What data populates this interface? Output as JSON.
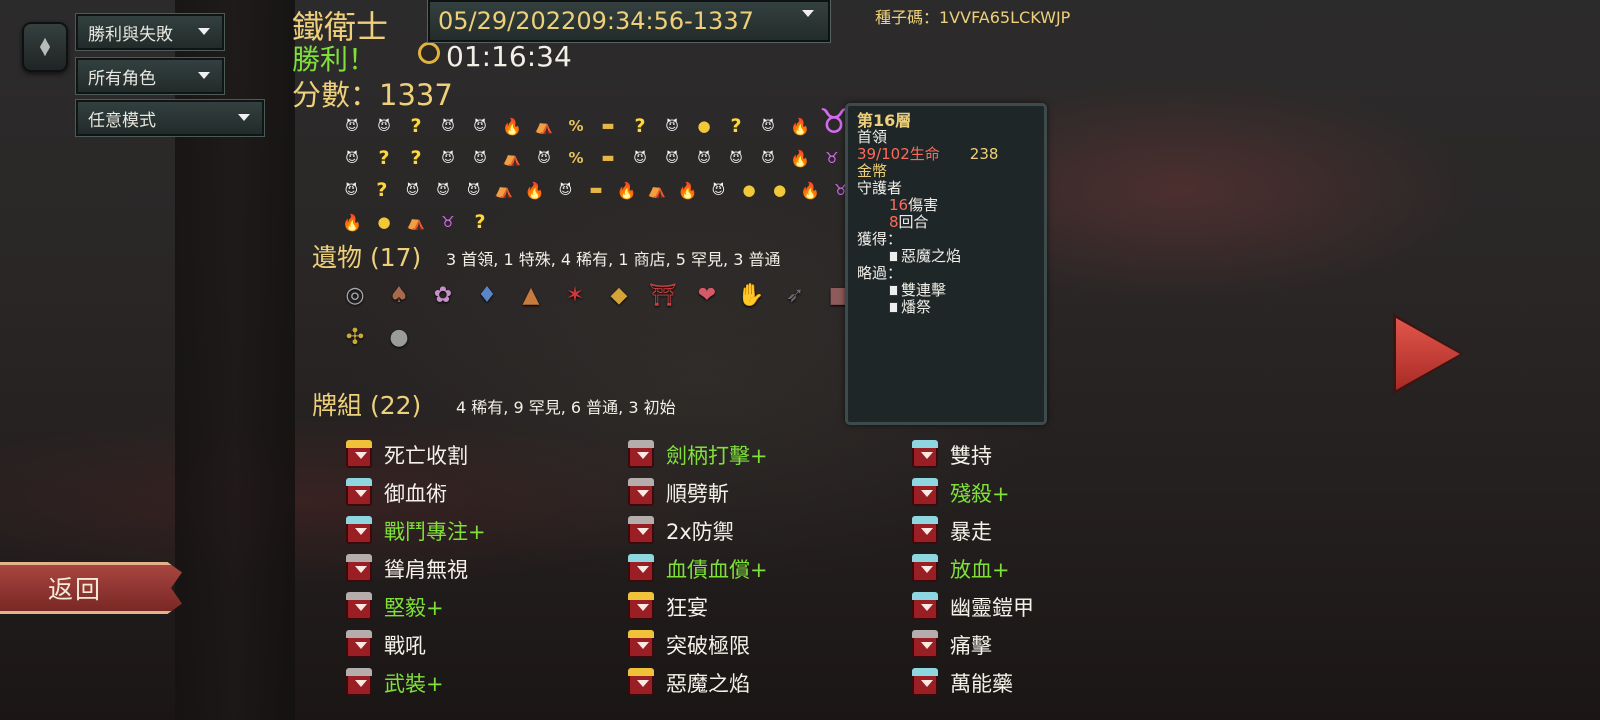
{
  "filters": {
    "outcome": "勝利與失敗",
    "character": "所有角色",
    "mode": "任意模式"
  },
  "run": {
    "character_name": "鐵衛士",
    "result": "勝利！",
    "score_text": "分數：1337",
    "play_time": "01:16:34",
    "run_select_value": "05/29/202209:34:56-1337",
    "seed_text": "種子碼：1VVFA65LCKWJP"
  },
  "path_map": {
    "rows": [
      [
        "monster",
        "monster",
        "unknown",
        "monster",
        "monster",
        "elite",
        "rest",
        "shop",
        "chest",
        "unknown",
        "monster",
        "treasure",
        "unknown",
        "monster",
        "elite"
      ],
      [
        "monster",
        "unknown",
        "unknown",
        "monster",
        "monster",
        "rest",
        "monster",
        "shop",
        "chest",
        "monster",
        "monster",
        "monster",
        "monster",
        "monster",
        "elite",
        "boss"
      ],
      [
        "monster",
        "unknown",
        "monster",
        "monster",
        "monster",
        "rest",
        "elite",
        "monster",
        "chest",
        "elite",
        "rest",
        "elite",
        "monster",
        "treasure",
        "treasure",
        "elite",
        "boss"
      ],
      [
        "elite",
        "treasure",
        "rest",
        "boss",
        "unknown"
      ]
    ],
    "icons": {
      "monster": "😈",
      "elite": "🔥",
      "unknown": "?",
      "rest": "⛺",
      "shop": "%",
      "chest": "▬",
      "treasure": "●",
      "boss": "♉"
    }
  },
  "relics": {
    "heading": "遺物 (17)",
    "summary": "3 首領, 1 特殊, 4 稀有, 1 商店, 5 罕見, 3 普通",
    "items": [
      {
        "name": "ring-relic",
        "glyph": "◎",
        "color": "#a7a9b0"
      },
      {
        "name": "hat-relic",
        "glyph": "♠",
        "color": "#a86a4c"
      },
      {
        "name": "turnip-relic",
        "glyph": "✿",
        "color": "#c58fc8"
      },
      {
        "name": "bag-relic",
        "glyph": "♦",
        "color": "#5a86c8"
      },
      {
        "name": "pyramid-relic",
        "glyph": "▲",
        "color": "#c77b3e"
      },
      {
        "name": "horn-relic",
        "glyph": "✶",
        "color": "#c83a3a"
      },
      {
        "name": "shield-relic",
        "glyph": "◆",
        "color": "#d4a436"
      },
      {
        "name": "torii-relic",
        "glyph": "⛩",
        "color": "#c84040"
      },
      {
        "name": "candy-relic",
        "glyph": "❤",
        "color": "#d65a66"
      },
      {
        "name": "claw-relic",
        "glyph": "✋",
        "color": "#b8453a"
      },
      {
        "name": "kunai-relic",
        "glyph": "➶",
        "color": "#6b6c72"
      },
      {
        "name": "tablet-relic",
        "glyph": "■",
        "color": "#8e5a5a"
      },
      {
        "name": "vajra-relic",
        "glyph": "✣",
        "color": "#c8a838"
      },
      {
        "name": "stone-relic",
        "glyph": "●",
        "color": "#9a9c9c"
      }
    ]
  },
  "deck": {
    "heading": "牌組 (22)",
    "summary": "4 稀有, 9 罕見, 6 普通, 3 初始",
    "columns": [
      [
        {
          "name": "死亡收割",
          "rarity": "rare",
          "upgraded": false
        },
        {
          "name": "御血術",
          "rarity": "uncommon",
          "upgraded": false
        },
        {
          "name": "戰鬥專注+",
          "rarity": "uncommon",
          "upgraded": true
        },
        {
          "name": "聳肩無視",
          "rarity": "common",
          "upgraded": false
        },
        {
          "name": "堅毅+",
          "rarity": "common",
          "upgraded": true
        },
        {
          "name": "戰吼",
          "rarity": "common",
          "upgraded": false
        },
        {
          "name": "武裝+",
          "rarity": "common",
          "upgraded": true
        }
      ],
      [
        {
          "name": "劍柄打擊+",
          "rarity": "common",
          "upgraded": true
        },
        {
          "name": "順劈斬",
          "rarity": "common",
          "upgraded": false
        },
        {
          "name": "2x防禦",
          "rarity": "common",
          "upgraded": false
        },
        {
          "name": "血債血償+",
          "rarity": "uncommon",
          "upgraded": true
        },
        {
          "name": "狂宴",
          "rarity": "rare",
          "upgraded": false
        },
        {
          "name": "突破極限",
          "rarity": "rare",
          "upgraded": false
        },
        {
          "name": "惡魔之焰",
          "rarity": "rare",
          "upgraded": false
        }
      ],
      [
        {
          "name": "雙持",
          "rarity": "uncommon",
          "upgraded": false
        },
        {
          "name": "殘殺+",
          "rarity": "uncommon",
          "upgraded": true
        },
        {
          "name": "暴走",
          "rarity": "uncommon",
          "upgraded": false
        },
        {
          "name": "放血+",
          "rarity": "uncommon",
          "upgraded": true
        },
        {
          "name": "幽靈鎧甲",
          "rarity": "uncommon",
          "upgraded": false
        },
        {
          "name": "痛擊",
          "rarity": "common",
          "upgraded": false
        },
        {
          "name": "萬能藥",
          "rarity": "uncommon",
          "upgraded": false
        }
      ]
    ]
  },
  "tooltip": {
    "title": "第16層",
    "type": "首領",
    "hp": "39/102生命",
    "gold_value": "238",
    "gold_label": "金幣",
    "enemy": "守護者",
    "damage_value": "16",
    "damage_label": "傷害",
    "turns_value": "8",
    "turns_label": "回合",
    "obtained_label": "獲得：",
    "obtained_item": "惡魔之焰",
    "skipped_label": "略過：",
    "skipped_items": [
      "雙連擊",
      "燔祭"
    ]
  },
  "buttons": {
    "return_label": "返回"
  },
  "colors": {
    "gold": "#eed07a",
    "green": "#7fe03a",
    "red": "#ff6a5a"
  }
}
